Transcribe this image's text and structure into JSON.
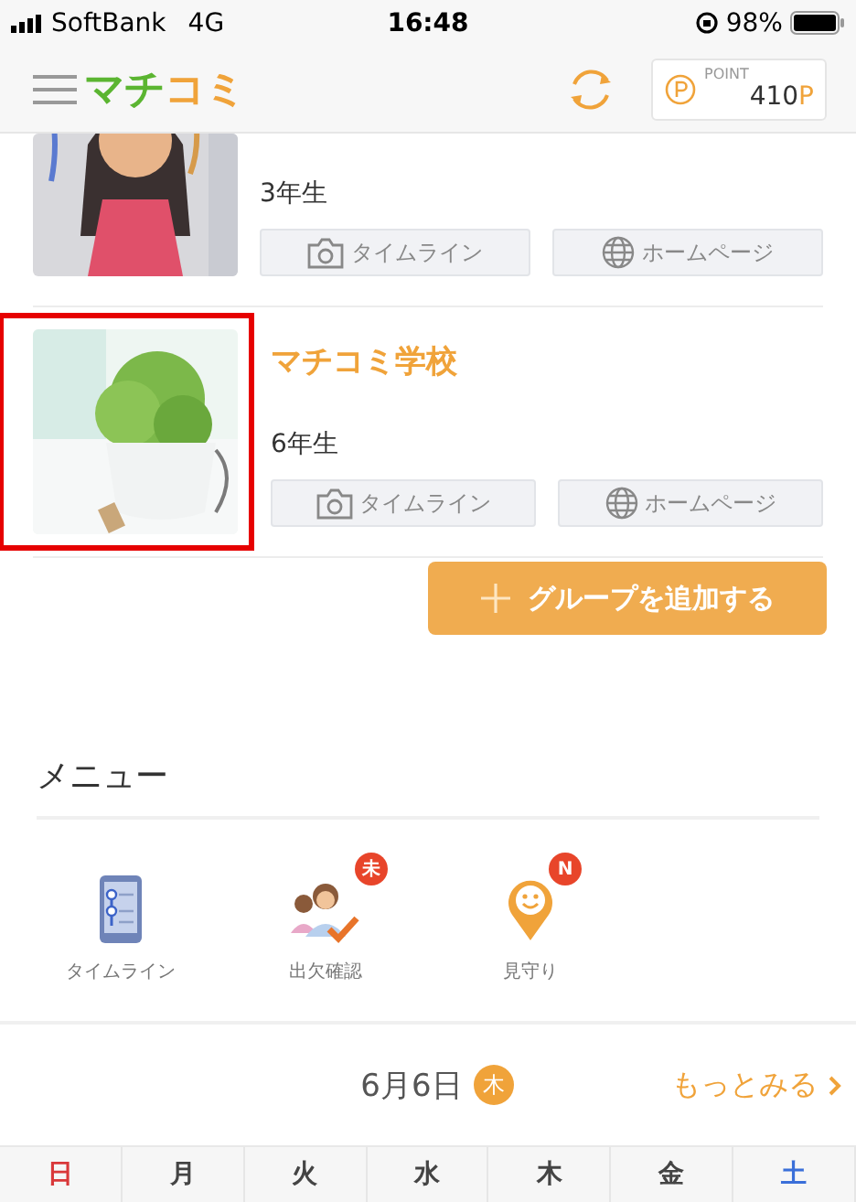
{
  "status_bar": {
    "carrier": "SoftBank",
    "network": "4G",
    "time": "16:48",
    "battery": "98%"
  },
  "header": {
    "logo": [
      {
        "text": "マチ",
        "color": "#5bb531"
      },
      {
        "text": "コミ",
        "color": "#f0a33a"
      }
    ],
    "points": {
      "label": "POINT",
      "value": "410",
      "unit": "P"
    }
  },
  "groups": [
    {
      "grade": "3年生",
      "highlighted": false,
      "cut": true,
      "buttons": [
        {
          "kind": "timeline",
          "label": "タイムライン"
        },
        {
          "kind": "homepage",
          "label": "ホームページ"
        }
      ]
    },
    {
      "name": "マチコミ学校",
      "grade": "6年生",
      "highlighted": true,
      "cut": false,
      "buttons": [
        {
          "kind": "timeline",
          "label": "タイムライン"
        },
        {
          "kind": "homepage",
          "label": "ホームページ"
        }
      ]
    }
  ],
  "add_group_button": "グループを追加する",
  "menu": {
    "title": "メニュー",
    "items": [
      {
        "kind": "timeline",
        "label": "タイムライン"
      },
      {
        "kind": "attendance",
        "label": "出欠確認",
        "badge": "未"
      },
      {
        "kind": "watch",
        "label": "見守り",
        "badge": "N"
      }
    ]
  },
  "calendar": {
    "date": "6月6日",
    "weekday": "木",
    "more": "もっとみる",
    "days": [
      {
        "label": "日",
        "color": "#d9383a"
      },
      {
        "label": "月",
        "color": "#444444"
      },
      {
        "label": "火",
        "color": "#444444"
      },
      {
        "label": "水",
        "color": "#444444"
      },
      {
        "label": "木",
        "color": "#444444"
      },
      {
        "label": "金",
        "color": "#444444"
      },
      {
        "label": "土",
        "color": "#3a6fd9"
      }
    ]
  }
}
